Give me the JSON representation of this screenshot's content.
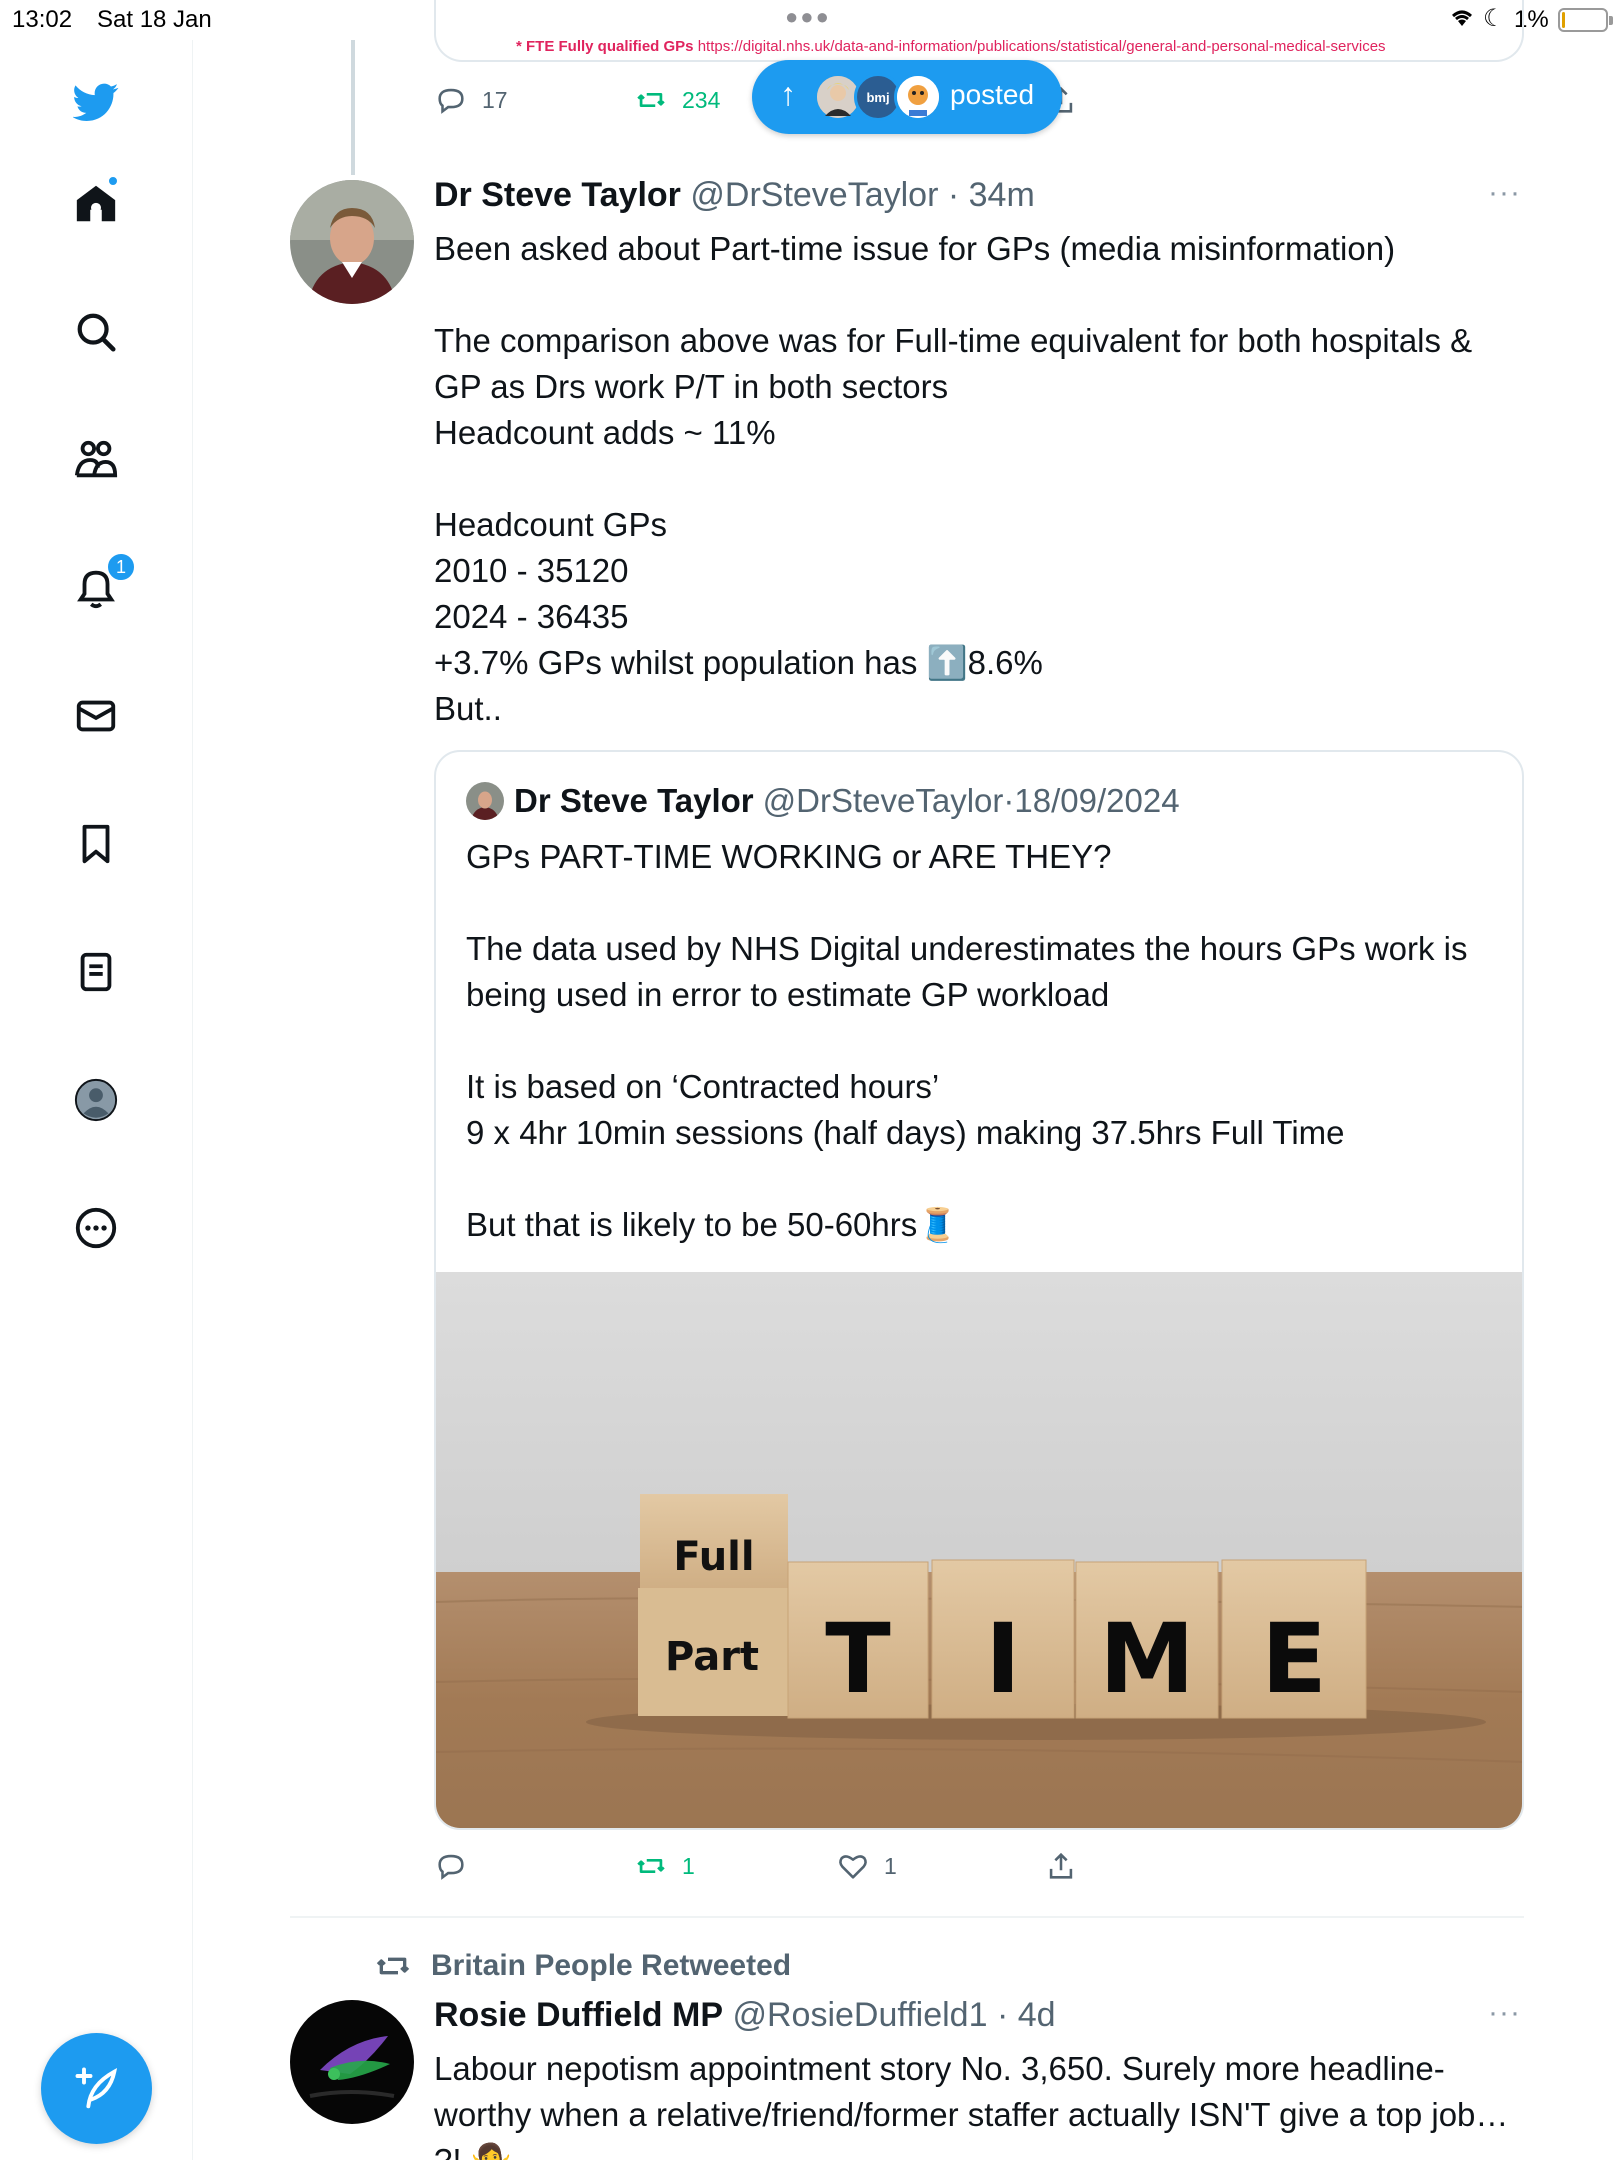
{
  "status_bar": {
    "time": "13:02",
    "date": "Sat 18 Jan",
    "battery": "1%"
  },
  "sidebar": {
    "notifications_count": "1",
    "items": [
      "twitter-logo",
      "home-icon",
      "search-icon",
      "communities-icon",
      "notifications-icon",
      "messages-icon",
      "bookmarks-icon",
      "lists-icon",
      "profile-icon",
      "more-icon"
    ]
  },
  "previous_tweet": {
    "source_label": "* FTE Fully qualified GPs",
    "source_url": "https://digital.nhs.uk/data-and-information/publications/statistical/general-and-personal-medical-services",
    "replies": "17",
    "retweets": "234"
  },
  "posted_pill": {
    "label": "posted",
    "bmj_label": "bmj"
  },
  "tweet": {
    "name": "Dr Steve Taylor",
    "handle": "@DrSteveTaylor",
    "sep": "·",
    "time": "34m",
    "body": "Been asked about Part-time issue for GPs (media misinformation)\n\nThe comparison above was for Full-time equivalent for both hospitals & GP as Drs work P/T in both sectors\nHeadcount adds ~ 11%\n\nHeadcount GPs\n2010 - 35120\n2024 - 36435\n+3.7% GPs whilst population has ⬆️8.6%\nBut..",
    "quote": {
      "name": "Dr Steve Taylor",
      "handle": "@DrSteveTaylor",
      "sep": "·",
      "date": "18/09/2024",
      "body": "GPs PART-TIME WORKING or ARE THEY?\n\nThe data used by NHS Digital underestimates the hours GPs work is being used in error to estimate GP workload\n\nIt is based on ‘Contracted hours’\n9 x 4hr 10min sessions (half days) making 37.5hrs Full Time\n\nBut that is likely to be 50-60hrs🧵",
      "image_blocks": {
        "full": "Full",
        "part": "Part",
        "letters": [
          "T",
          "I",
          "M",
          "E"
        ]
      }
    },
    "replies": "",
    "retweets": "1",
    "likes": "1"
  },
  "next_tweet": {
    "retweeted_by": "Britain People Retweeted",
    "name": "Rosie Duffield MP",
    "handle": "@RosieDuffield1",
    "sep": "·",
    "time": "4d",
    "body": "Labour nepotism appointment story No. 3,650. Surely more headline-worthy when a relative/friend/former staffer actually ISN'T give a top job… ?! 🤷‍♀️"
  }
}
